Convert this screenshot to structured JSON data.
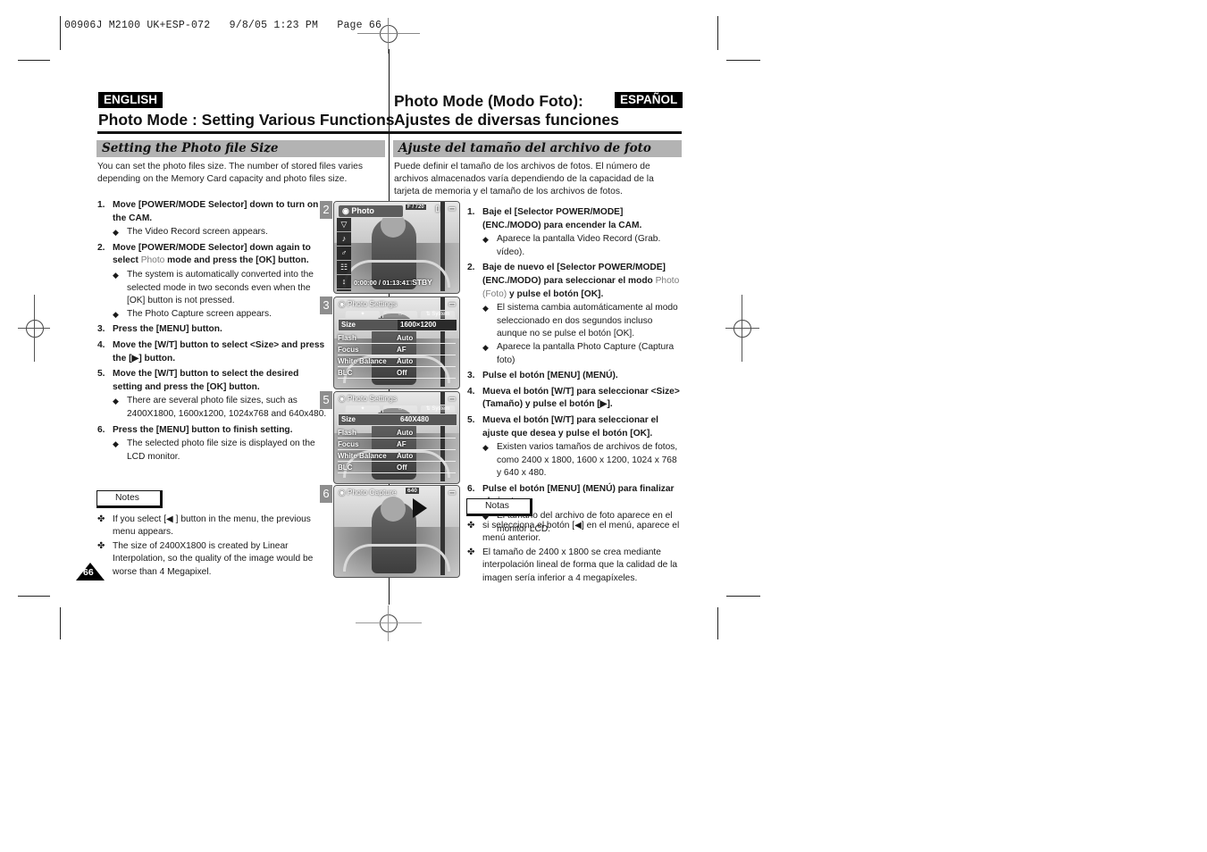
{
  "print_slug": "00906J M2100 UK+ESP-072   9/8/05 1:23 PM   Page 66",
  "english": {
    "lang_tag": "ENGLISH",
    "title": "Photo Mode : Setting Various Functions",
    "section": "Setting the Photo file Size",
    "intro": "You can set the photo files size. The number of stored files varies depending on the Memory Card capacity and photo files size.",
    "steps": [
      {
        "num": "1.",
        "text": "Move [POWER/MODE Selector] down to turn on the CAM.",
        "bullets": [
          "The Video Record screen appears."
        ]
      },
      {
        "num": "2.",
        "text_before": "Move [POWER/MODE Selector] down again to select ",
        "highlight": "Photo",
        "text_after": " mode and press the [OK] button.",
        "bullets": [
          "The system is automatically converted into the selected mode in two seconds even when the [OK] button is not pressed.",
          "The Photo Capture screen appears."
        ]
      },
      {
        "num": "3.",
        "text": "Press the [MENU] button.",
        "bullets": []
      },
      {
        "num": "4.",
        "text": "Move the [W/T] button to select <Size> and press the [▶] button.",
        "bullets": []
      },
      {
        "num": "5.",
        "text": "Move the [W/T] button to select the desired setting and press the [OK] button.",
        "bullets": [
          "There are several photo file sizes, such as 2400X1800, 1600x1200, 1024x768 and 640x480."
        ]
      },
      {
        "num": "6.",
        "text": "Press the [MENU] button to finish setting.",
        "bullets": [
          "The selected photo file size is displayed on the LCD monitor."
        ]
      }
    ],
    "notes_label": "Notes",
    "notes": [
      "If you select [◀ ] button in the menu, the previous menu appears.",
      "The size of 2400X1800 is created by Linear Interpolation, so the quality of the image would be worse than 4 Megapixel."
    ],
    "page_number": "66"
  },
  "espanol": {
    "lang_tag": "ESPAÑOL",
    "title_line1": "Photo Mode (Modo Foto):",
    "title_line2": "Ajustes de diversas funciones",
    "section": "Ajuste del tamaño del archivo de foto",
    "intro": "Puede definir el tamaño de los archivos de fotos. El número de archivos almacenados varía dependiendo de la capacidad de la tarjeta de memoria y el tamaño de los archivos de fotos.",
    "steps": [
      {
        "num": "1.",
        "text": "Baje el [Selector POWER/MODE] (ENC./MODO) para encender la CAM.",
        "bullets": [
          "Aparece la pantalla Video Record (Grab. vídeo)."
        ]
      },
      {
        "num": "2.",
        "text_before": "Baje de nuevo el [Selector POWER/MODE] (ENC./MODO) para seleccionar el modo ",
        "highlight": "Photo (Foto)",
        "text_after": " y pulse el botón [OK].",
        "bullets": [
          "El sistema cambia automáticamente al modo seleccionado en dos segundos incluso aunque no se pulse el botón [OK].",
          "Aparece la pantalla Photo Capture (Captura foto)"
        ]
      },
      {
        "num": "3.",
        "text": "Pulse el botón [MENU] (MENÚ).",
        "bullets": []
      },
      {
        "num": "4.",
        "text": "Mueva el botón [W/T] para seleccionar <Size> (Tamaño) y pulse el botón [▶].",
        "bullets": []
      },
      {
        "num": "5.",
        "text": "Mueva el botón [W/T] para seleccionar el ajuste que desea y pulse el botón [OK].",
        "bullets": [
          "Existen varios tamaños de archivos de fotos, como 2400 x 1800, 1600 x 1200, 1024 x 768 y 640 x 480."
        ]
      },
      {
        "num": "6.",
        "text": "Pulse el botón [MENU] (MENÚ) para finalizar el ajuste.",
        "bullets": [
          "El tamaño del archivo de foto aparece en el monitor LCD."
        ]
      }
    ],
    "notes_label": "Notas",
    "notes": [
      "si selecciona el botón [◀] en el menú, aparece el menú anterior.",
      "El tamaño de 2400 x 1800 se crea mediante interpolación lineal de forma que la calidad de la imagen sería inferior a 4 megapíxeles."
    ]
  },
  "bullet_glyph": "◆",
  "note_glyph": "✤",
  "screens": [
    {
      "step": "2",
      "menu_label": "Photo",
      "counter": "F / 720",
      "timecode": "0:00:00 / 01:13:41",
      "status": "STBY",
      "sidebar_icons": [
        "▽",
        "♪",
        "♂",
        "☷",
        "↕",
        "⚇"
      ]
    },
    {
      "step": "3",
      "header": "Photo Settings",
      "tabs": [
        "✦",
        "⌂",
        "⇅ System"
      ],
      "selected": {
        "label": "Size",
        "value": "1600×1200"
      },
      "rows": [
        {
          "label": "Flash",
          "value": "Auto"
        },
        {
          "label": "Focus",
          "value": "AF"
        },
        {
          "label": "White Balance",
          "value": "Auto"
        },
        {
          "label": "BLC",
          "value": "Off"
        }
      ]
    },
    {
      "step": "5",
      "header": "Photo Settings",
      "tabs": [
        "✦",
        "⌂",
        "⇅ System"
      ],
      "selected": {
        "label": "Size",
        "value": "640X480"
      },
      "rows": [
        {
          "label": "Flash",
          "value": "Auto"
        },
        {
          "label": "Focus",
          "value": "AF"
        },
        {
          "label": "White Balance",
          "value": "Auto"
        },
        {
          "label": "BLC",
          "value": "Off"
        }
      ]
    },
    {
      "step": "6",
      "header": "Photo Capture",
      "counter": "640"
    }
  ]
}
